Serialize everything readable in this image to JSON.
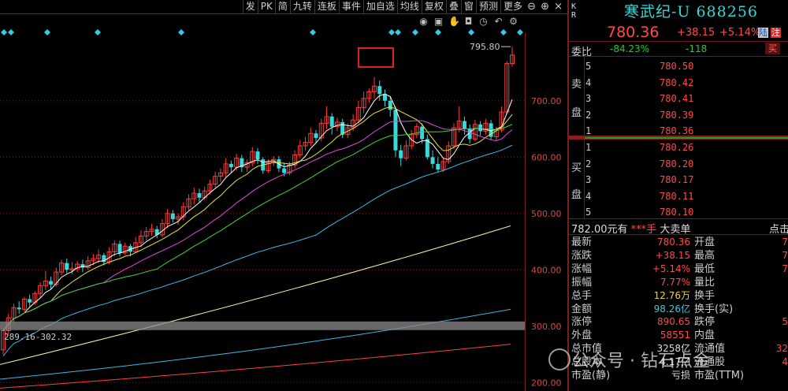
{
  "menu": [
    "发",
    "PK",
    "简",
    "九转",
    "连板",
    "事件",
    "加自选",
    "均线",
    "复权",
    "叠",
    "窗",
    "预测",
    "更多"
  ],
  "window_controls": {
    "minus": "⊖",
    "plus": "⊕",
    "close": "×"
  },
  "tools": [
    "eye-icon",
    "lock-icon",
    "hand-icon",
    "camera-icon",
    "clock-icon",
    "undo-icon",
    "gear-icon"
  ],
  "chart": {
    "y_ticks": [
      "700.00",
      "600.00",
      "500.00",
      "400.00",
      "300.00",
      "200.00"
    ],
    "high_label": "795.80",
    "low_label": "289.16-302.32",
    "colors": {
      "up": "#ff3c3c",
      "down": "#38d9dc",
      "ma5": "#ffffff",
      "ma10": "#e8e83c",
      "ma20": "#e04bd8",
      "ma30": "#3cd43c",
      "ma60": "#3cb8e8",
      "ma120": "#f0f0a0",
      "ma250": "#ff4040",
      "grid": "#7a1e1e"
    }
  },
  "chart_data": {
    "type": "candlestick",
    "ylim": [
      185,
      820
    ],
    "y_ticks": [
      700,
      600,
      500,
      400,
      300,
      200
    ],
    "candles": [
      [
        258,
        292,
        250,
        296
      ],
      [
        292,
        315,
        286,
        322
      ],
      [
        314,
        333,
        305,
        340
      ],
      [
        333,
        330,
        322,
        344
      ],
      [
        330,
        348,
        326,
        352
      ],
      [
        348,
        342,
        335,
        356
      ],
      [
        342,
        358,
        338,
        362
      ],
      [
        358,
        372,
        350,
        378
      ],
      [
        372,
        380,
        364,
        398
      ],
      [
        380,
        374,
        366,
        388
      ],
      [
        374,
        396,
        370,
        404
      ],
      [
        396,
        412,
        390,
        418
      ],
      [
        412,
        400,
        394,
        420
      ],
      [
        400,
        402,
        392,
        414
      ],
      [
        402,
        410,
        396,
        416
      ],
      [
        410,
        404,
        396,
        418
      ],
      [
        404,
        416,
        400,
        424
      ],
      [
        416,
        420,
        408,
        428
      ],
      [
        420,
        426,
        412,
        436
      ],
      [
        426,
        414,
        408,
        430
      ],
      [
        414,
        432,
        410,
        440
      ],
      [
        432,
        446,
        424,
        452
      ],
      [
        446,
        430,
        424,
        452
      ],
      [
        430,
        442,
        426,
        448
      ],
      [
        442,
        432,
        424,
        446
      ],
      [
        432,
        448,
        430,
        458
      ],
      [
        448,
        460,
        440,
        470
      ],
      [
        460,
        468,
        452,
        476
      ],
      [
        468,
        472,
        460,
        482
      ],
      [
        472,
        462,
        456,
        478
      ],
      [
        462,
        482,
        458,
        490
      ],
      [
        482,
        500,
        474,
        508
      ],
      [
        500,
        490,
        484,
        506
      ],
      [
        490,
        494,
        480,
        500
      ],
      [
        494,
        512,
        488,
        520
      ],
      [
        512,
        526,
        506,
        534
      ],
      [
        526,
        536,
        516,
        546
      ],
      [
        536,
        528,
        520,
        544
      ],
      [
        528,
        540,
        524,
        548
      ],
      [
        540,
        552,
        534,
        560
      ],
      [
        552,
        566,
        546,
        574
      ],
      [
        566,
        572,
        556,
        580
      ],
      [
        572,
        588,
        564,
        598
      ],
      [
        588,
        582,
        572,
        594
      ],
      [
        582,
        598,
        576,
        606
      ],
      [
        598,
        582,
        574,
        604
      ],
      [
        582,
        590,
        574,
        596
      ],
      [
        590,
        610,
        584,
        618
      ],
      [
        610,
        596,
        588,
        616
      ],
      [
        596,
        576,
        570,
        600
      ],
      [
        576,
        590,
        572,
        596
      ],
      [
        590,
        596,
        584,
        602
      ],
      [
        596,
        580,
        574,
        602
      ],
      [
        580,
        572,
        566,
        590
      ],
      [
        572,
        586,
        568,
        592
      ],
      [
        586,
        604,
        580,
        612
      ],
      [
        604,
        620,
        598,
        630
      ],
      [
        620,
        626,
        612,
        636
      ],
      [
        626,
        642,
        620,
        652
      ],
      [
        642,
        634,
        626,
        648
      ],
      [
        634,
        660,
        628,
        668
      ],
      [
        660,
        672,
        650,
        690
      ],
      [
        672,
        654,
        640,
        678
      ],
      [
        654,
        662,
        646,
        670
      ],
      [
        662,
        640,
        634,
        668
      ],
      [
        640,
        652,
        634,
        660
      ],
      [
        652,
        666,
        646,
        676
      ],
      [
        666,
        688,
        660,
        700
      ],
      [
        688,
        704,
        678,
        716
      ],
      [
        704,
        716,
        696,
        722
      ],
      [
        716,
        726,
        704,
        742
      ],
      [
        726,
        712,
        700,
        736
      ],
      [
        712,
        700,
        690,
        720
      ],
      [
        700,
        684,
        672,
        708
      ],
      [
        684,
        612,
        600,
        690
      ],
      [
        612,
        598,
        584,
        622
      ],
      [
        598,
        620,
        594,
        630
      ],
      [
        620,
        640,
        614,
        648
      ],
      [
        640,
        654,
        634,
        660
      ],
      [
        654,
        632,
        624,
        660
      ],
      [
        632,
        600,
        596,
        640
      ],
      [
        600,
        588,
        580,
        612
      ],
      [
        588,
        578,
        574,
        600
      ],
      [
        578,
        592,
        574,
        598
      ],
      [
        592,
        620,
        588,
        628
      ],
      [
        620,
        652,
        614,
        660
      ],
      [
        652,
        664,
        644,
        690
      ],
      [
        664,
        650,
        640,
        672
      ],
      [
        650,
        632,
        624,
        658
      ],
      [
        632,
        658,
        628,
        666
      ],
      [
        658,
        646,
        638,
        664
      ],
      [
        646,
        660,
        640,
        668
      ],
      [
        660,
        636,
        630,
        666
      ],
      [
        636,
        648,
        630,
        654
      ],
      [
        648,
        680,
        644,
        690
      ],
      [
        680,
        766,
        676,
        770
      ],
      [
        766,
        781,
        760,
        796
      ]
    ]
  },
  "quote": {
    "kr": [
      "K",
      "R"
    ],
    "name": "寒武纪-U 688256",
    "last": "780.36",
    "change": "+38.15",
    "pct": "+5.14%",
    "badge1": "陆",
    "badge2": "注",
    "webi_label": "委比",
    "webi": "-84.23%",
    "weicha": "-118",
    "sell_btn": "买"
  },
  "orderbook": {
    "sell_side": "卖盘",
    "buy_side": "买盘",
    "asks": [
      {
        "level": "5",
        "price": "780.50"
      },
      {
        "level": "4",
        "price": "780.42"
      },
      {
        "level": "3",
        "price": "780.41"
      },
      {
        "level": "2",
        "price": "780.39"
      },
      {
        "level": "1",
        "price": "780.36"
      }
    ],
    "bids": [
      {
        "level": "1",
        "price": "780.26"
      },
      {
        "level": "2",
        "price": "780.20"
      },
      {
        "level": "3",
        "price": "780.17"
      },
      {
        "level": "4",
        "price": "780.11"
      },
      {
        "level": "5",
        "price": "780.10"
      }
    ]
  },
  "preference": {
    "price": "782.00",
    "unit": "元有",
    "stars": "***手",
    "tag": "大卖单",
    "more": "点击"
  },
  "stats": [
    {
      "label": "最新",
      "value": "780.36",
      "color": "red",
      "label2": "开盘",
      "value2": "7"
    },
    {
      "label": "涨跌",
      "value": "+38.15",
      "color": "red",
      "label2": "最高",
      "value2": "7"
    },
    {
      "label": "涨幅",
      "value": "+5.14%",
      "color": "red",
      "label2": "最低",
      "value2": "7"
    },
    {
      "label": "振幅",
      "value": "7.77%",
      "color": "red",
      "label2": "量比",
      "value2": ""
    },
    {
      "label": "总手",
      "value": "12.76万",
      "color": "yel",
      "label2": "换手",
      "value2": ""
    },
    {
      "label": "金额",
      "value": "98.26亿",
      "color": "cyan",
      "label2": "换手(实)",
      "value2": ""
    },
    {
      "label": "涨停",
      "value": "890.65",
      "color": "red",
      "label2": "跌停",
      "value2": "5"
    },
    {
      "label": "外盘",
      "value": "58551",
      "color": "red",
      "label2": "内盘",
      "value2": ""
    },
    {
      "label": "总市值",
      "value": "3258亿",
      "color": "wht",
      "label2": "流通值",
      "value2": "32"
    },
    {
      "label": "总股本",
      "value": "4.17亿",
      "color": "wht",
      "label2": "流通股",
      "value2": "4"
    },
    {
      "label": "市盈(静)",
      "value": "亏损",
      "color": "wht",
      "label2": "市盈(TTM)",
      "value2": ""
    }
  ],
  "watermark": "公众号 · 钻石点金"
}
